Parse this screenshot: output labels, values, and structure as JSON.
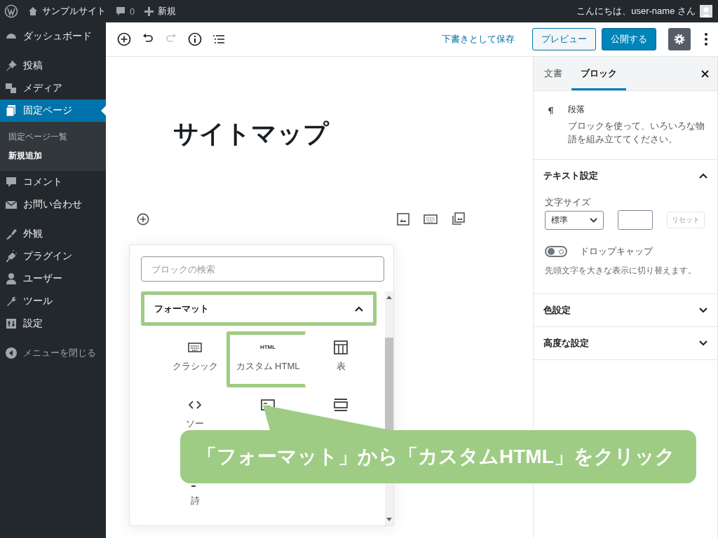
{
  "admin_bar": {
    "site_name": "サンプルサイト",
    "comments_count": "0",
    "new_label": "新規",
    "greeting": "こんにちは、user-name さん"
  },
  "sidebar": {
    "groups": [
      [
        {
          "label": "ダッシュボード",
          "selected": false
        }
      ],
      [
        {
          "label": "投稿",
          "selected": false
        },
        {
          "label": "メディア",
          "selected": false
        },
        {
          "label": "固定ページ",
          "selected": true,
          "children": [
            {
              "label": "固定ページ一覧",
              "selected": false
            },
            {
              "label": "新規追加",
              "selected": true
            }
          ]
        },
        {
          "label": "コメント",
          "selected": false
        },
        {
          "label": "お問い合わせ",
          "selected": false
        }
      ],
      [
        {
          "label": "外観",
          "selected": false
        },
        {
          "label": "プラグイン",
          "selected": false
        },
        {
          "label": "ユーザー",
          "selected": false
        },
        {
          "label": "ツール",
          "selected": false
        },
        {
          "label": "設定",
          "selected": false
        }
      ]
    ],
    "collapse_label": "メニューを閉じる"
  },
  "toolbar": {
    "redo_disabled": true,
    "save_draft": "下書きとして保存",
    "preview": "プレビュー",
    "publish": "公開する",
    "settings_active": true
  },
  "editor": {
    "title": "サイトマップ"
  },
  "inserter": {
    "search_placeholder": "ブロックの検索",
    "category": {
      "label": "フォーマット",
      "expanded": true,
      "highlighted": true
    },
    "blocks": [
      {
        "label": "クラシック",
        "highlighted": false
      },
      {
        "icon_text": "HTML",
        "label": "カスタム HTML",
        "highlighted": true
      },
      {
        "label": "表",
        "highlighted": false
      },
      {
        "label": "ソー",
        "highlighted": false
      },
      {
        "highlighted": false
      },
      {
        "highlighted": false
      },
      {
        "label": "詩",
        "highlighted": false
      }
    ]
  },
  "callout": {
    "text": "「フォーマット」から「カスタムHTML」をクリック"
  },
  "settings": {
    "tabs": [
      {
        "label": "文書",
        "selected": false
      },
      {
        "label": "ブロック",
        "selected": true
      }
    ],
    "block_card": {
      "title": "段落",
      "description": "ブロックを使って、いろいろな物語を組み立ててください。"
    },
    "panels": [
      {
        "title": "テキスト設定",
        "expanded": true,
        "content": {
          "font_size_label": "文字サイズ",
          "font_size_value": "標準",
          "reset_label": "リセット",
          "reset_disabled": true,
          "drop_cap": {
            "label": "ドロップキャップ",
            "on": false,
            "help": "先頭文字を大きな表示に切り替えます。"
          }
        }
      },
      {
        "title": "色設定",
        "expanded": false
      },
      {
        "title": "高度な設定",
        "expanded": false
      }
    ]
  }
}
